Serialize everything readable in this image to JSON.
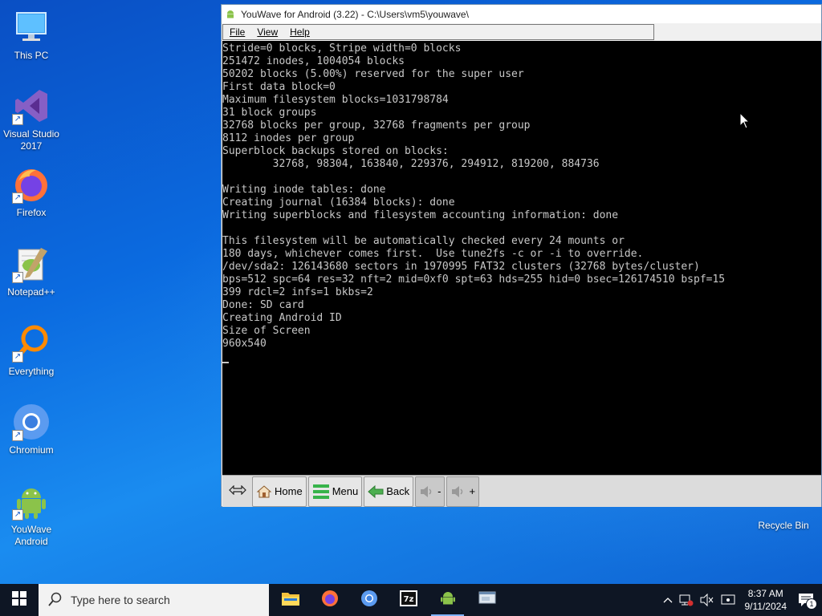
{
  "desktop": {
    "icons": [
      {
        "label": "This PC"
      },
      {
        "label": "Visual Studio 2017"
      },
      {
        "label": "Firefox"
      },
      {
        "label": "Notepad++"
      },
      {
        "label": "Everything"
      },
      {
        "label": "Chromium"
      },
      {
        "label": "YouWave Android"
      }
    ],
    "recycle_bin": "Recycle Bin"
  },
  "window": {
    "title": "YouWave for Android (3.22) - C:\\Users\\vm5\\youwave\\",
    "menu": {
      "file": "File",
      "view": "View",
      "help": "Help"
    },
    "console_text": "Stride=0 blocks, Stripe width=0 blocks\n251472 inodes, 1004054 blocks\n50202 blocks (5.00%) reserved for the super user\nFirst data block=0\nMaximum filesystem blocks=1031798784\n31 block groups\n32768 blocks per group, 32768 fragments per group\n8112 inodes per group\nSuperblock backups stored on blocks:\n        32768, 98304, 163840, 229376, 294912, 819200, 884736\n\nWriting inode tables: done\nCreating journal (16384 blocks): done\nWriting superblocks and filesystem accounting information: done\n\nThis filesystem will be automatically checked every 24 mounts or\n180 days, whichever comes first.  Use tune2fs -c or -i to override.\n/dev/sda2: 126143680 sectors in 1970995 FAT32 clusters (32768 bytes/cluster)\nbps=512 spc=64 res=32 nft=2 mid=0xf0 spt=63 hds=255 hid=0 bsec=126174510 bspf=15\n399 rdcl=2 infs=1 bkbs=2\nDone: SD card\nCreating Android ID\nSize of Screen\n960x540\n",
    "toolbar": {
      "home": "Home",
      "menu": "Menu",
      "back": "Back",
      "vol_down": "-",
      "vol_up": "+"
    }
  },
  "taskbar": {
    "search_placeholder": "Type here to search",
    "time": "8:37 AM",
    "date": "9/11/2024",
    "notifications_count": "1"
  },
  "colors": {
    "taskbar": "#0e1624",
    "console_bg": "#000000",
    "console_fg": "#c8c8c8",
    "accent": "#0b6be0"
  }
}
